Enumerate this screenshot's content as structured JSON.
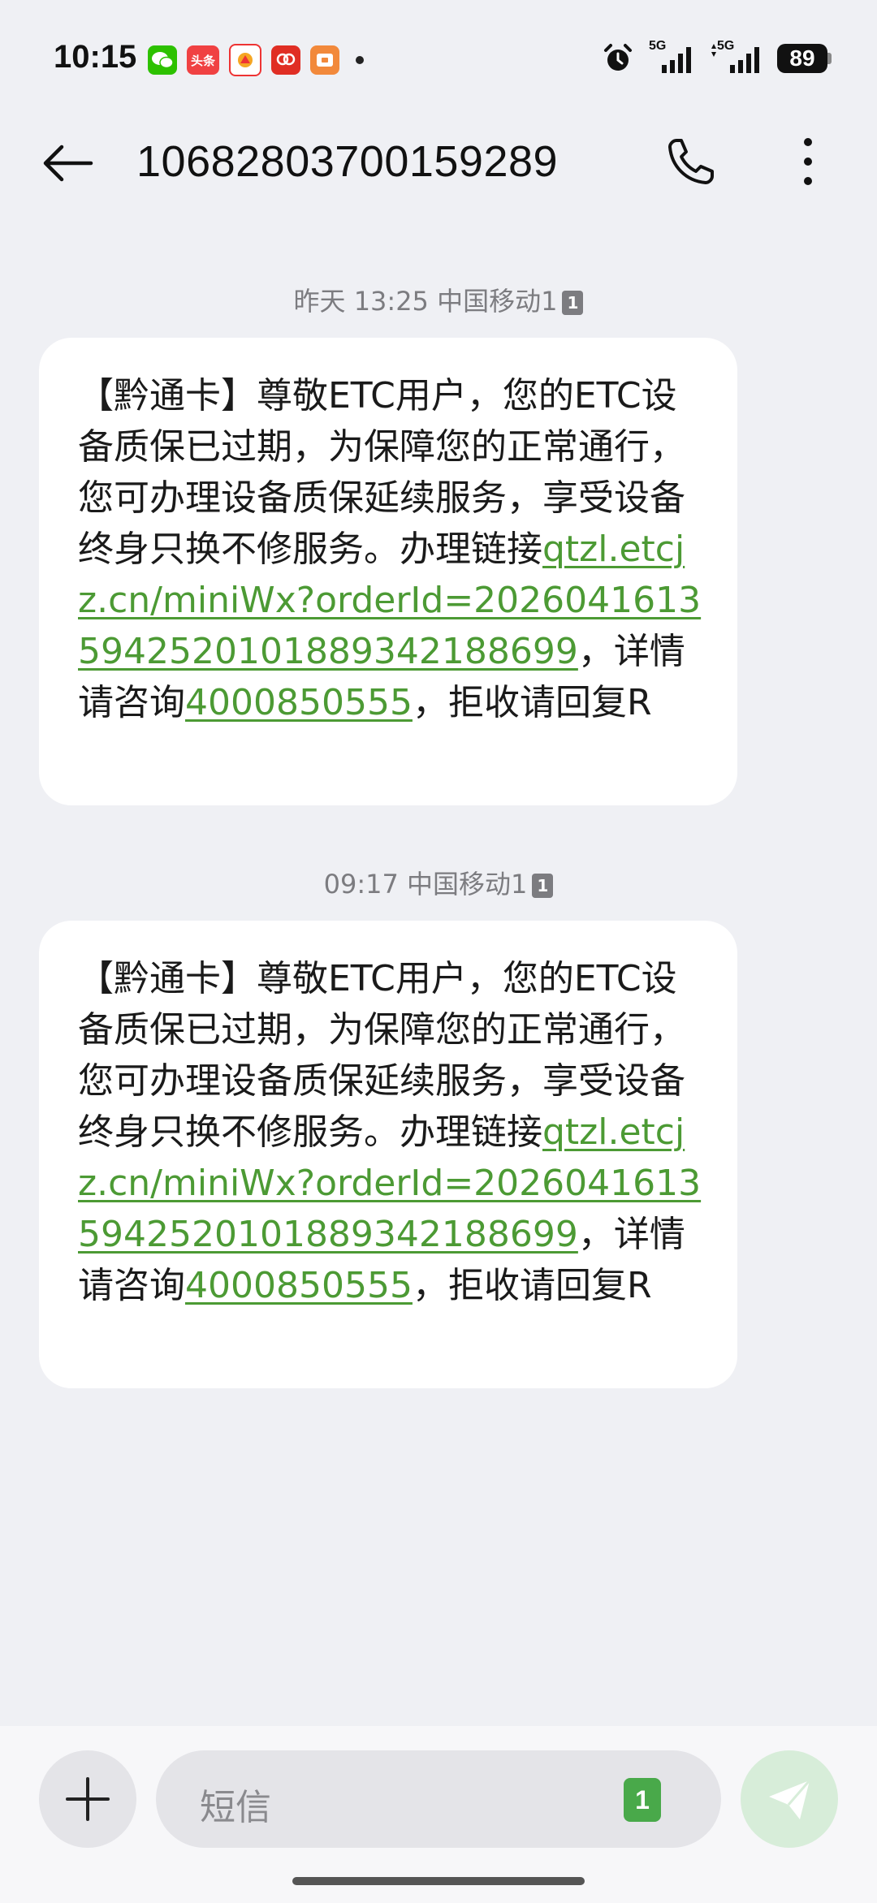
{
  "status_bar": {
    "time": "10:15",
    "app_icons": [
      "wechat-icon",
      "toutiao-icon",
      "app-icon",
      "pinduoduo-icon",
      "wallet-icon"
    ],
    "toutiao_label": "头条",
    "net1_label": "5G",
    "net2_label": "5G",
    "battery": "89"
  },
  "header": {
    "title": "10682803700159289"
  },
  "messages": [
    {
      "meta_time": "昨天 13:25",
      "meta_carrier": "中国移动1",
      "sim": "1",
      "text_before_link": "【黔通卡】尊敬ETC用户，您的ETC设备质保已过期，为保障您的正常通行，您可办理设备质保延续服务，享受设备终身只换不修服务。办理链接",
      "link": "qtzl.etcjz.cn/miniWx?orderId=2026041613594252010188934218​8699",
      "text_mid": "，详情请咨询",
      "phone": "4000850555",
      "text_end": "，拒收请回复R"
    },
    {
      "meta_time": "09:17",
      "meta_carrier": "中国移动1",
      "sim": "1",
      "text_before_link": "【黔通卡】尊敬ETC用户，您的ETC设备质保已过期，为保障您的正常通行，您可办理设备质保延续服务，享受设备终身只换不修服务。办理链接",
      "link": "qtzl.etcjz.cn/miniWx?orderId=2026041613594252010188934218​8699",
      "text_mid": "，详情请咨询",
      "phone": "4000850555",
      "text_end": "，拒收请回复R"
    }
  ],
  "input": {
    "placeholder": "短信",
    "sim": "1"
  },
  "colors": {
    "link": "#4c9a34",
    "background": "#eff0f4",
    "bubble": "#ffffff",
    "sim_badge": "#49a94a",
    "send_button": "#d7edd9"
  }
}
